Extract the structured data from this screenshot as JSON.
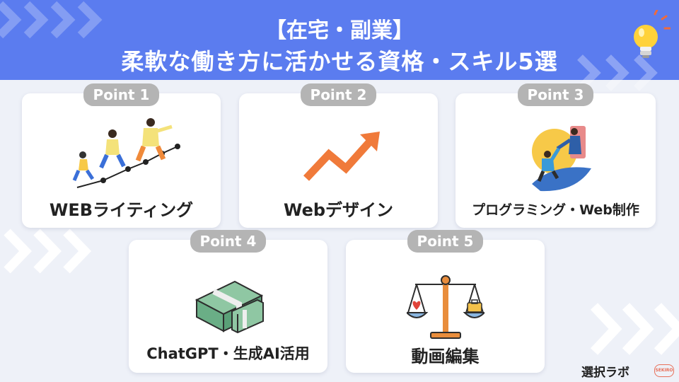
{
  "header": {
    "line1": "【在宅・副業】",
    "line2": "柔軟な働き方に活かせる資格・スキル5選",
    "background": "#5b7cef"
  },
  "cards": [
    {
      "badge": "Point 1",
      "label": "WEBライティング",
      "icon": "running-people-chart-icon"
    },
    {
      "badge": "Point 2",
      "label": "Webデザイン",
      "icon": "trend-up-arrow-icon"
    },
    {
      "badge": "Point 3",
      "label": "プログラミング・Web制作",
      "icon": "climbing-helping-hand-icon"
    },
    {
      "badge": "Point 4",
      "label": "ChatGPT・生成AI活用",
      "icon": "money-stacks-icon"
    },
    {
      "badge": "Point 5",
      "label": "動画編集",
      "icon": "balance-scale-icon"
    }
  ],
  "logo": {
    "text": "選択ラボ",
    "stamp": "SEKIRO"
  },
  "colors": {
    "accent": "#5b7cef",
    "badge": "#b4b4b4",
    "orange": "#f07a3a"
  }
}
